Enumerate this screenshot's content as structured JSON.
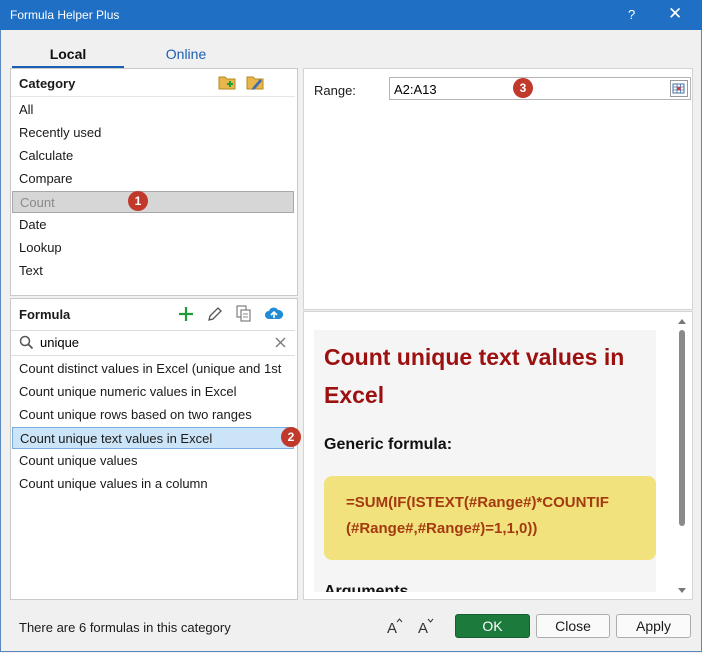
{
  "window": {
    "title": "Formula Helper Plus",
    "help": "?",
    "close": "✕"
  },
  "tabs": [
    {
      "label": "Local"
    },
    {
      "label": "Online"
    }
  ],
  "category": {
    "header": "Category",
    "items": [
      "All",
      "Recently used",
      "Calculate",
      "Compare",
      "Count",
      "Date",
      "Lookup",
      "Text"
    ],
    "selected": "Count",
    "badge": "1"
  },
  "formula": {
    "header": "Formula",
    "search_value": "unique",
    "items": [
      "Count distinct values in Excel (unique and 1st",
      "Count unique numeric values in Excel",
      "Count unique rows based on two ranges",
      "Count unique text values in Excel",
      "Count unique values",
      "Count unique values in a column"
    ],
    "selected": "Count unique text values in Excel",
    "badge": "2"
  },
  "range": {
    "label": "Range:",
    "value": "A2:A13",
    "badge": "3"
  },
  "preview": {
    "title": "Count unique text values in Excel",
    "generic_label": "Generic formula:",
    "formula_line1": "=SUM(IF(ISTEXT(#Range#)*COUNTIF",
    "formula_line2": "(#Range#,#Range#)=1,1,0))",
    "arguments_label": "Arguments"
  },
  "status": "There are 6 formulas in this category",
  "buttons": {
    "ok": "OK",
    "close": "Close",
    "apply": "Apply"
  },
  "colors": {
    "title_bar": "#1f6fc4",
    "ok_button": "#1b7a3c",
    "badge": "#c0392b",
    "preview_title": "#9c1010",
    "formula_box": "#f2e27e"
  }
}
